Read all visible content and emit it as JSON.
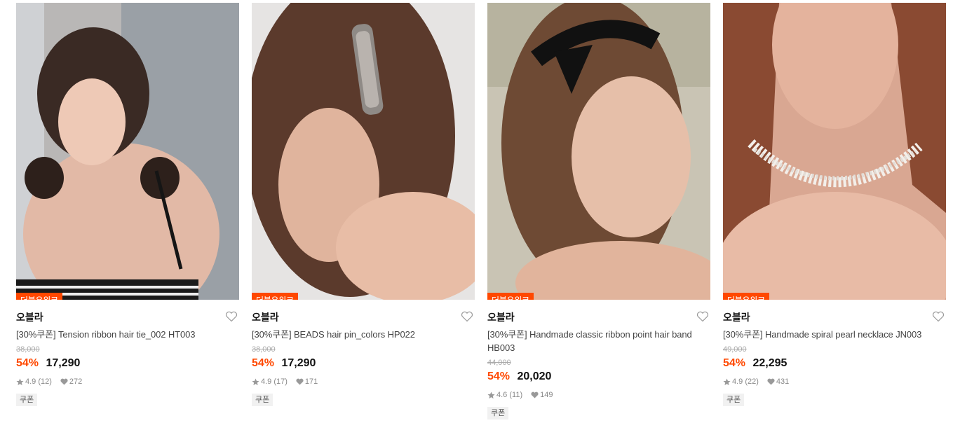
{
  "products": [
    {
      "badge": "더블유위크",
      "brand": "오블라",
      "title": "[30%쿠폰] Tension ribbon hair tie_002 HT003",
      "original_price": "38,000",
      "discount": "54%",
      "price": "17,290",
      "rating": "4.9",
      "review_count": "(12)",
      "likes": "272",
      "coupon_label": "쿠폰",
      "image_desc": "woman-ribbon-hair-tie-photo"
    },
    {
      "badge": "더블유위크",
      "brand": "오블라",
      "title": "[30%쿠폰] BEADS hair pin_colors HP022",
      "original_price": "38,000",
      "discount": "54%",
      "price": "17,290",
      "rating": "4.9",
      "review_count": "(17)",
      "likes": "171",
      "coupon_label": "쿠폰",
      "image_desc": "beaded-hair-pin-photo"
    },
    {
      "badge": "더블유위크",
      "brand": "오블라",
      "title": "[30%쿠폰] Handmade classic ribbon point hair band HB003",
      "original_price": "44,000",
      "discount": "54%",
      "price": "20,020",
      "rating": "4.6",
      "review_count": "(11)",
      "likes": "149",
      "coupon_label": "쿠폰",
      "image_desc": "ribbon-hair-band-photo"
    },
    {
      "badge": "더블유위크",
      "brand": "오블라",
      "title": "[30%쿠폰] Handmade spiral pearl necklace JN003",
      "original_price": "49,000",
      "discount": "54%",
      "price": "22,295",
      "rating": "4.9",
      "review_count": "(22)",
      "likes": "431",
      "coupon_label": "쿠폰",
      "image_desc": "pearl-necklace-photo"
    }
  ],
  "colors": {
    "accent": "#ff4800",
    "price": "#111111",
    "muted": "#aaaaaa"
  }
}
